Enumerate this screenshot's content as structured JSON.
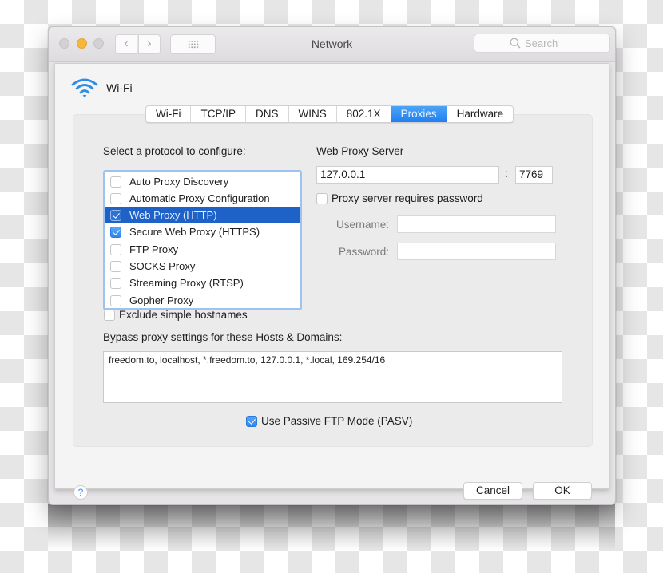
{
  "window": {
    "title": "Network",
    "search_placeholder": "Search",
    "back_glyph": "‹",
    "forward_glyph": "›"
  },
  "connection": {
    "name": "Wi-Fi",
    "icon": "wifi-icon"
  },
  "tabs": [
    {
      "label": "Wi-Fi",
      "active": false
    },
    {
      "label": "TCP/IP",
      "active": false
    },
    {
      "label": "DNS",
      "active": false
    },
    {
      "label": "WINS",
      "active": false
    },
    {
      "label": "802.1X",
      "active": false
    },
    {
      "label": "Proxies",
      "active": true
    },
    {
      "label": "Hardware",
      "active": false
    }
  ],
  "proxies": {
    "protocol_heading": "Select a protocol to configure:",
    "protocols": [
      {
        "label": "Auto Proxy Discovery",
        "checked": false,
        "selected": false
      },
      {
        "label": "Automatic Proxy Configuration",
        "checked": false,
        "selected": false
      },
      {
        "label": "Web Proxy (HTTP)",
        "checked": true,
        "selected": true
      },
      {
        "label": "Secure Web Proxy (HTTPS)",
        "checked": true,
        "selected": false
      },
      {
        "label": "FTP Proxy",
        "checked": false,
        "selected": false
      },
      {
        "label": "SOCKS Proxy",
        "checked": false,
        "selected": false
      },
      {
        "label": "Streaming Proxy (RTSP)",
        "checked": false,
        "selected": false
      },
      {
        "label": "Gopher Proxy",
        "checked": false,
        "selected": false
      }
    ],
    "exclude_simple_hostnames": {
      "label": "Exclude simple hostnames",
      "checked": false
    },
    "server_heading": "Web Proxy Server",
    "server_address": "127.0.0.1",
    "port_separator": ":",
    "server_port": "7769",
    "requires_password": {
      "label": "Proxy server requires password",
      "checked": false
    },
    "username_label": "Username:",
    "username_value": "",
    "password_label": "Password:",
    "password_value": "",
    "bypass_heading": "Bypass proxy settings for these Hosts & Domains:",
    "bypass_value": "freedom.to, localhost, *.freedom.to, 127.0.0.1, *.local, 169.254/16",
    "passive_ftp": {
      "label": "Use Passive FTP Mode (PASV)",
      "checked": true
    }
  },
  "footer": {
    "help_label": "?",
    "cancel_label": "Cancel",
    "ok_label": "OK"
  },
  "colors": {
    "accent": "#1f7ff0",
    "selection": "#1e62c8",
    "minimize": "#f6b73a"
  }
}
